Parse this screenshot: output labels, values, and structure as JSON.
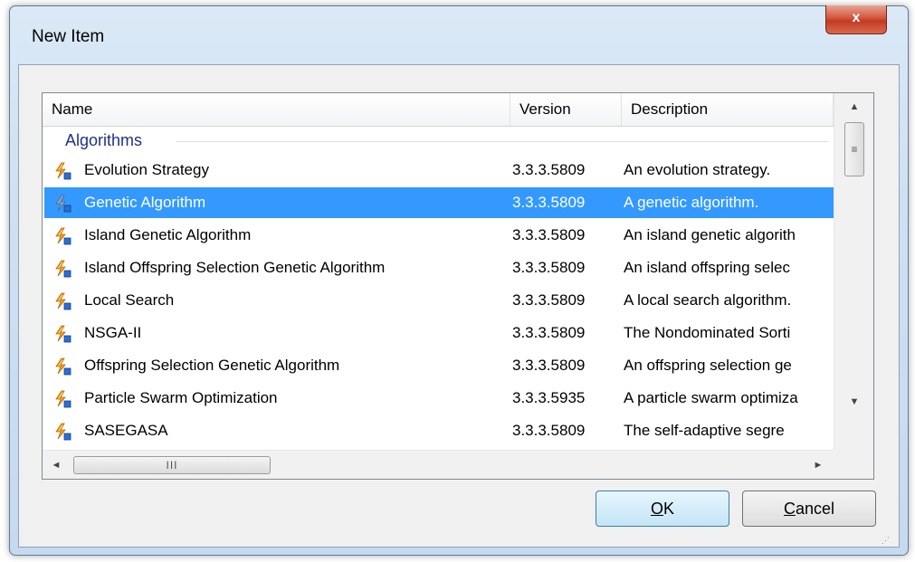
{
  "window": {
    "title": "New Item",
    "close_glyph": "x"
  },
  "list": {
    "columns": [
      {
        "label": "Name"
      },
      {
        "label": "Version"
      },
      {
        "label": "Description"
      }
    ],
    "group": "Algorithms",
    "rows": [
      {
        "name": "Evolution Strategy",
        "version": "3.3.3.5809",
        "description": "An evolution strategy.",
        "selected": false
      },
      {
        "name": "Genetic Algorithm",
        "version": "3.3.3.5809",
        "description": "A genetic algorithm.",
        "selected": true
      },
      {
        "name": "Island Genetic Algorithm",
        "version": "3.3.3.5809",
        "description": "An island genetic algorith",
        "selected": false
      },
      {
        "name": "Island Offspring Selection Genetic Algorithm",
        "version": "3.3.3.5809",
        "description": "An island offspring selec",
        "selected": false
      },
      {
        "name": "Local Search",
        "version": "3.3.3.5809",
        "description": "A local search algorithm.",
        "selected": false
      },
      {
        "name": "NSGA-II",
        "version": "3.3.3.5809",
        "description": "The Nondominated Sorti",
        "selected": false
      },
      {
        "name": "Offspring Selection Genetic Algorithm",
        "version": "3.3.3.5809",
        "description": "An offspring selection ge",
        "selected": false
      },
      {
        "name": "Particle Swarm Optimization",
        "version": "3.3.3.5935",
        "description": "A particle swarm optimiza",
        "selected": false
      },
      {
        "name": "SASEGASA",
        "version": "3.3.3.5809",
        "description": "The self-adaptive segre",
        "selected": false
      }
    ],
    "row_icon": "algorithm-lightning-icon"
  },
  "scrollbars": {
    "up_arrow": "▲",
    "down_arrow": "▼",
    "left_arrow": "◄",
    "right_arrow": "►",
    "vthumb_grip": "≡",
    "hthumb_grip": "III"
  },
  "buttons": {
    "ok_accel": "O",
    "ok_rest": "K",
    "cancel_accel": "C",
    "cancel_rest": "ancel"
  },
  "colors": {
    "selection": "#3399ff",
    "group_text": "#1e3287"
  }
}
